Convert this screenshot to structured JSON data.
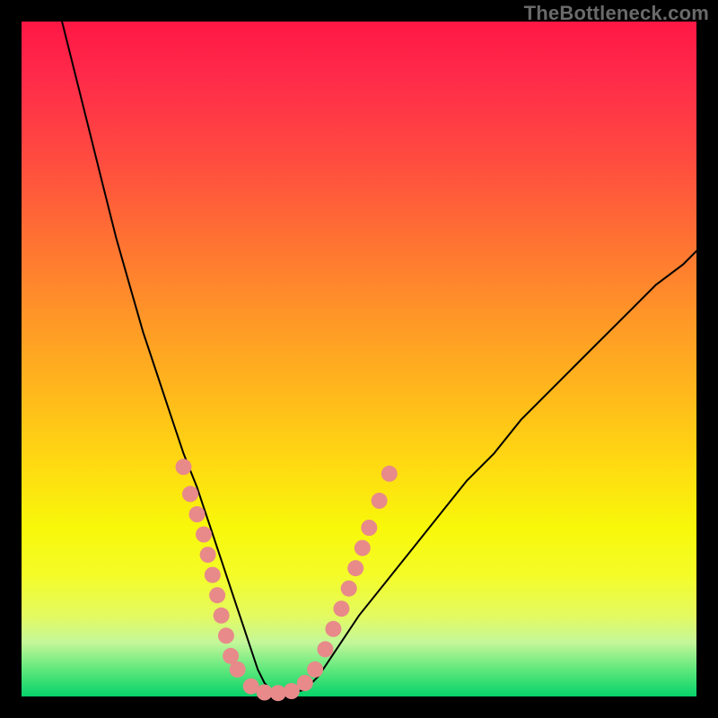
{
  "watermark": "TheBottleneck.com",
  "chart_data": {
    "type": "line",
    "title": "",
    "xlabel": "",
    "ylabel": "",
    "xlim": [
      0,
      100
    ],
    "ylim": [
      0,
      100
    ],
    "background_gradient": {
      "top": "#ff1744",
      "mid": "#ffd812",
      "bottom": "#06d26a"
    },
    "series": [
      {
        "name": "curve-primary",
        "stroke": "#000000",
        "stroke_width": 2,
        "x": [
          6,
          8,
          10,
          12,
          14,
          16,
          18,
          20,
          22,
          24,
          26,
          27,
          28,
          29,
          30,
          31,
          32,
          33,
          34,
          35,
          36,
          37,
          38,
          40,
          42,
          44,
          46,
          48,
          50,
          54,
          58,
          62,
          66,
          70,
          74,
          78,
          82,
          86,
          90,
          94,
          98,
          100
        ],
        "values": [
          100,
          92,
          84,
          76,
          68,
          61,
          54,
          48,
          42,
          36,
          31,
          28,
          25,
          22,
          19,
          16,
          13,
          10,
          7,
          4,
          2,
          1,
          0.5,
          0.5,
          1,
          3,
          6,
          9,
          12,
          17,
          22,
          27,
          32,
          36,
          41,
          45,
          49,
          53,
          57,
          61,
          64,
          66
        ]
      }
    ],
    "markers": [
      {
        "name": "marker-cluster",
        "fill": "#e88a8a",
        "radius": 9,
        "points": [
          {
            "x": 24,
            "y": 34
          },
          {
            "x": 25,
            "y": 30
          },
          {
            "x": 26,
            "y": 27
          },
          {
            "x": 27,
            "y": 24
          },
          {
            "x": 27.6,
            "y": 21
          },
          {
            "x": 28.3,
            "y": 18
          },
          {
            "x": 29,
            "y": 15
          },
          {
            "x": 29.6,
            "y": 12
          },
          {
            "x": 30.3,
            "y": 9
          },
          {
            "x": 31,
            "y": 6
          },
          {
            "x": 32,
            "y": 4
          },
          {
            "x": 34,
            "y": 1.5
          },
          {
            "x": 36,
            "y": 0.6
          },
          {
            "x": 38,
            "y": 0.5
          },
          {
            "x": 40,
            "y": 0.8
          },
          {
            "x": 42,
            "y": 2
          },
          {
            "x": 43.5,
            "y": 4
          },
          {
            "x": 45,
            "y": 7
          },
          {
            "x": 46.2,
            "y": 10
          },
          {
            "x": 47.4,
            "y": 13
          },
          {
            "x": 48.5,
            "y": 16
          },
          {
            "x": 49.5,
            "y": 19
          },
          {
            "x": 50.5,
            "y": 22
          },
          {
            "x": 51.5,
            "y": 25
          },
          {
            "x": 53,
            "y": 29
          },
          {
            "x": 54.5,
            "y": 33
          }
        ]
      }
    ]
  }
}
